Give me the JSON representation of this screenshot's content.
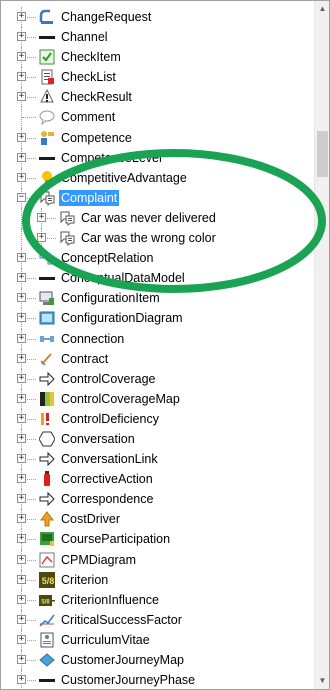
{
  "tree": {
    "items": [
      {
        "label": "ChangeRequest",
        "icon": "change-request-icon",
        "level": 0,
        "expanded": false
      },
      {
        "label": "Channel",
        "icon": "channel-icon",
        "level": 0,
        "expanded": false
      },
      {
        "label": "CheckItem",
        "icon": "checkitem-icon",
        "level": 0,
        "expanded": false
      },
      {
        "label": "CheckList",
        "icon": "checklist-icon",
        "level": 0,
        "expanded": false
      },
      {
        "label": "CheckResult",
        "icon": "checkresult-icon",
        "level": 0,
        "expanded": false
      },
      {
        "label": "Comment",
        "icon": "comment-icon",
        "level": 0,
        "expanded": null
      },
      {
        "label": "Competence",
        "icon": "competence-icon",
        "level": 0,
        "expanded": false
      },
      {
        "label": "CompetenceLevel",
        "icon": "competence-level-icon",
        "level": 0,
        "expanded": false
      },
      {
        "label": "CompetitiveAdvantage",
        "icon": "competitive-advantage-icon",
        "level": 0,
        "expanded": false
      },
      {
        "label": "Complaint",
        "icon": "complaint-icon",
        "level": 0,
        "expanded": true,
        "selected": true
      },
      {
        "label": "Car was never delivered",
        "icon": "complaint-icon",
        "level": 1,
        "expanded": false
      },
      {
        "label": "Car was the wrong color",
        "icon": "complaint-icon",
        "level": 1,
        "expanded": false
      },
      {
        "label": "ConceptRelation",
        "icon": "concept-relation-icon",
        "level": 0,
        "expanded": false
      },
      {
        "label": "ConceptualDataModel",
        "icon": "conceptual-data-model-icon",
        "level": 0,
        "expanded": false
      },
      {
        "label": "ConfigurationItem",
        "icon": "configuration-item-icon",
        "level": 0,
        "expanded": false
      },
      {
        "label": "ConfigurationDiagram",
        "icon": "configuration-diagram-icon",
        "level": 0,
        "expanded": false
      },
      {
        "label": "Connection",
        "icon": "connection-icon",
        "level": 0,
        "expanded": false
      },
      {
        "label": "Contract",
        "icon": "contract-icon",
        "level": 0,
        "expanded": false
      },
      {
        "label": "ControlCoverage",
        "icon": "control-coverage-icon",
        "level": 0,
        "expanded": false
      },
      {
        "label": "ControlCoverageMap",
        "icon": "control-coverage-map-icon",
        "level": 0,
        "expanded": false
      },
      {
        "label": "ControlDeficiency",
        "icon": "control-deficiency-icon",
        "level": 0,
        "expanded": false
      },
      {
        "label": "Conversation",
        "icon": "conversation-icon",
        "level": 0,
        "expanded": false
      },
      {
        "label": "ConversationLink",
        "icon": "conversation-link-icon",
        "level": 0,
        "expanded": false
      },
      {
        "label": "CorrectiveAction",
        "icon": "corrective-action-icon",
        "level": 0,
        "expanded": false
      },
      {
        "label": "Correspondence",
        "icon": "correspondence-icon",
        "level": 0,
        "expanded": false
      },
      {
        "label": "CostDriver",
        "icon": "cost-driver-icon",
        "level": 0,
        "expanded": false
      },
      {
        "label": "CourseParticipation",
        "icon": "course-participation-icon",
        "level": 0,
        "expanded": false
      },
      {
        "label": "CPMDiagram",
        "icon": "cpm-diagram-icon",
        "level": 0,
        "expanded": false
      },
      {
        "label": "Criterion",
        "icon": "criterion-icon",
        "level": 0,
        "expanded": false,
        "icon_text": "5/8"
      },
      {
        "label": "CriterionInfluence",
        "icon": "criterion-influence-icon",
        "level": 0,
        "expanded": false,
        "icon_text": "5/8"
      },
      {
        "label": "CriticalSuccessFactor",
        "icon": "critical-success-factor-icon",
        "level": 0,
        "expanded": false
      },
      {
        "label": "CurriculumVitae",
        "icon": "curriculum-vitae-icon",
        "level": 0,
        "expanded": false
      },
      {
        "label": "CustomerJourneyMap",
        "icon": "customer-journey-map-icon",
        "level": 0,
        "expanded": false
      },
      {
        "label": "CustomerJourneyPhase",
        "icon": "customer-journey-phase-icon",
        "level": 0,
        "expanded": false
      }
    ]
  },
  "colors": {
    "selection": "#3399ff",
    "annotation_ellipse": "#1aa353"
  },
  "scrollbar": {
    "up_icon": "scroll-up-arrow-icon",
    "down_icon": "scroll-down-arrow-icon"
  }
}
